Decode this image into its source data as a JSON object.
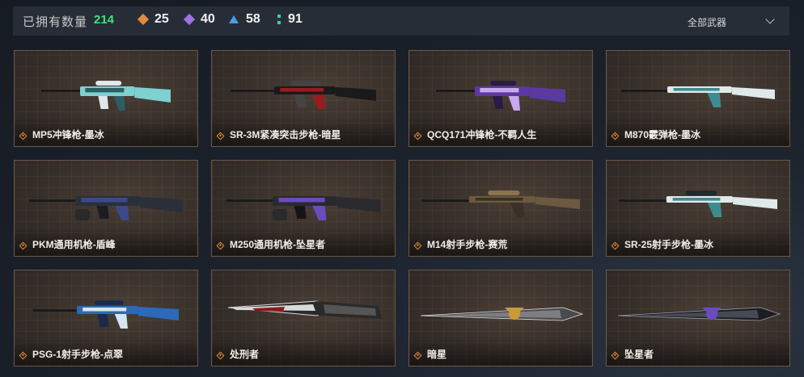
{
  "header": {
    "owned_label": "已拥有数量",
    "owned_count": "214",
    "stats": [
      {
        "icon": "orange-diamond-icon",
        "value": "25",
        "color": "#e08b3c"
      },
      {
        "icon": "purple-diamond-icon",
        "value": "40",
        "color": "#a070e6"
      },
      {
        "icon": "blue-triangle-icon",
        "value": "58",
        "color": "#4a9ee8"
      },
      {
        "icon": "green-colon-icon",
        "value": "91",
        "color": "#38d1a8"
      }
    ],
    "filter_label": "全部武器"
  },
  "weapons": [
    {
      "name": "MP5冲锋枪-墨冰",
      "rarity": "orange",
      "kind": "smg",
      "palette": [
        "#7fd0d0",
        "#2c5e64",
        "#dfe8ea"
      ]
    },
    {
      "name": "SR-3M紧凑突击步枪-暗星",
      "rarity": "orange",
      "kind": "rifle",
      "palette": [
        "#1a1a1a",
        "#9a1b1b",
        "#444444"
      ]
    },
    {
      "name": "QCQ171冲锋枪-不羁人生",
      "rarity": "orange",
      "kind": "smg",
      "palette": [
        "#5a3aa0",
        "#c9a8f0",
        "#2a1a48"
      ]
    },
    {
      "name": "M870霰弹枪-墨冰",
      "rarity": "orange",
      "kind": "shotgun",
      "palette": [
        "#dfe9ea",
        "#3f8b90",
        "#a9d4d6"
      ]
    },
    {
      "name": "PKM通用机枪-盾峰",
      "rarity": "orange",
      "kind": "mg",
      "palette": [
        "#2b2f3a",
        "#3c4a8a",
        "#1c1c22"
      ]
    },
    {
      "name": "M250通用机枪-坠星者",
      "rarity": "orange",
      "kind": "mg",
      "palette": [
        "#2a2a2e",
        "#6a4cc0",
        "#151518"
      ]
    },
    {
      "name": "M14射手步枪-赛荒",
      "rarity": "orange",
      "kind": "sniper",
      "palette": [
        "#6b5a40",
        "#3a3026",
        "#8a7450"
      ]
    },
    {
      "name": "SR-25射手步枪-墨冰",
      "rarity": "orange",
      "kind": "sniper",
      "palette": [
        "#dfe9ea",
        "#3f8b90",
        "#1e2b2e"
      ]
    },
    {
      "name": "PSG-1射手步枪-点翠",
      "rarity": "orange",
      "kind": "rifle",
      "palette": [
        "#2a6ab8",
        "#d8e4ef",
        "#1a2a48"
      ]
    },
    {
      "name": "处刑者",
      "rarity": "orange",
      "kind": "knife",
      "palette": [
        "#d9d9d9",
        "#8a1c1c",
        "#2a2a2a"
      ]
    },
    {
      "name": "暗星",
      "rarity": "orange",
      "kind": "blade",
      "palette": [
        "#4a4a4e",
        "#c99a3a",
        "#e0e0e0"
      ]
    },
    {
      "name": "坠星者",
      "rarity": "orange",
      "kind": "blade",
      "palette": [
        "#1c1c22",
        "#6a4cc0",
        "#9aa0b0"
      ]
    }
  ]
}
